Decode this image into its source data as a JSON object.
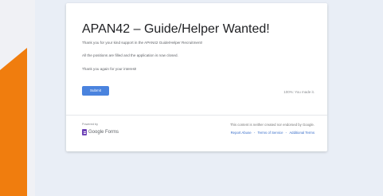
{
  "form": {
    "title": "APAN42 – Guide/Helper Wanted!",
    "messages": [
      "Thank you for your kind support in the APAN42 Guide/Helper Recruitment!",
      "All the positions are filled and the application is now closed.",
      "Thank you again for your interest!"
    ],
    "submit_label": "Submit",
    "progress_text": "100%: You made it."
  },
  "footer": {
    "powered_by": "Powered by",
    "brand": "Google Forms",
    "disclaimer": "This content is neither created nor endorsed by Google.",
    "links": [
      "Report Abuse",
      "Terms of Service",
      "Additional Terms"
    ],
    "separator": "-"
  },
  "colors": {
    "accent": "#4a83de",
    "orange_tab": "#f07d0e",
    "brand_icon": "#6f44b7",
    "background": "#e9eef6"
  }
}
